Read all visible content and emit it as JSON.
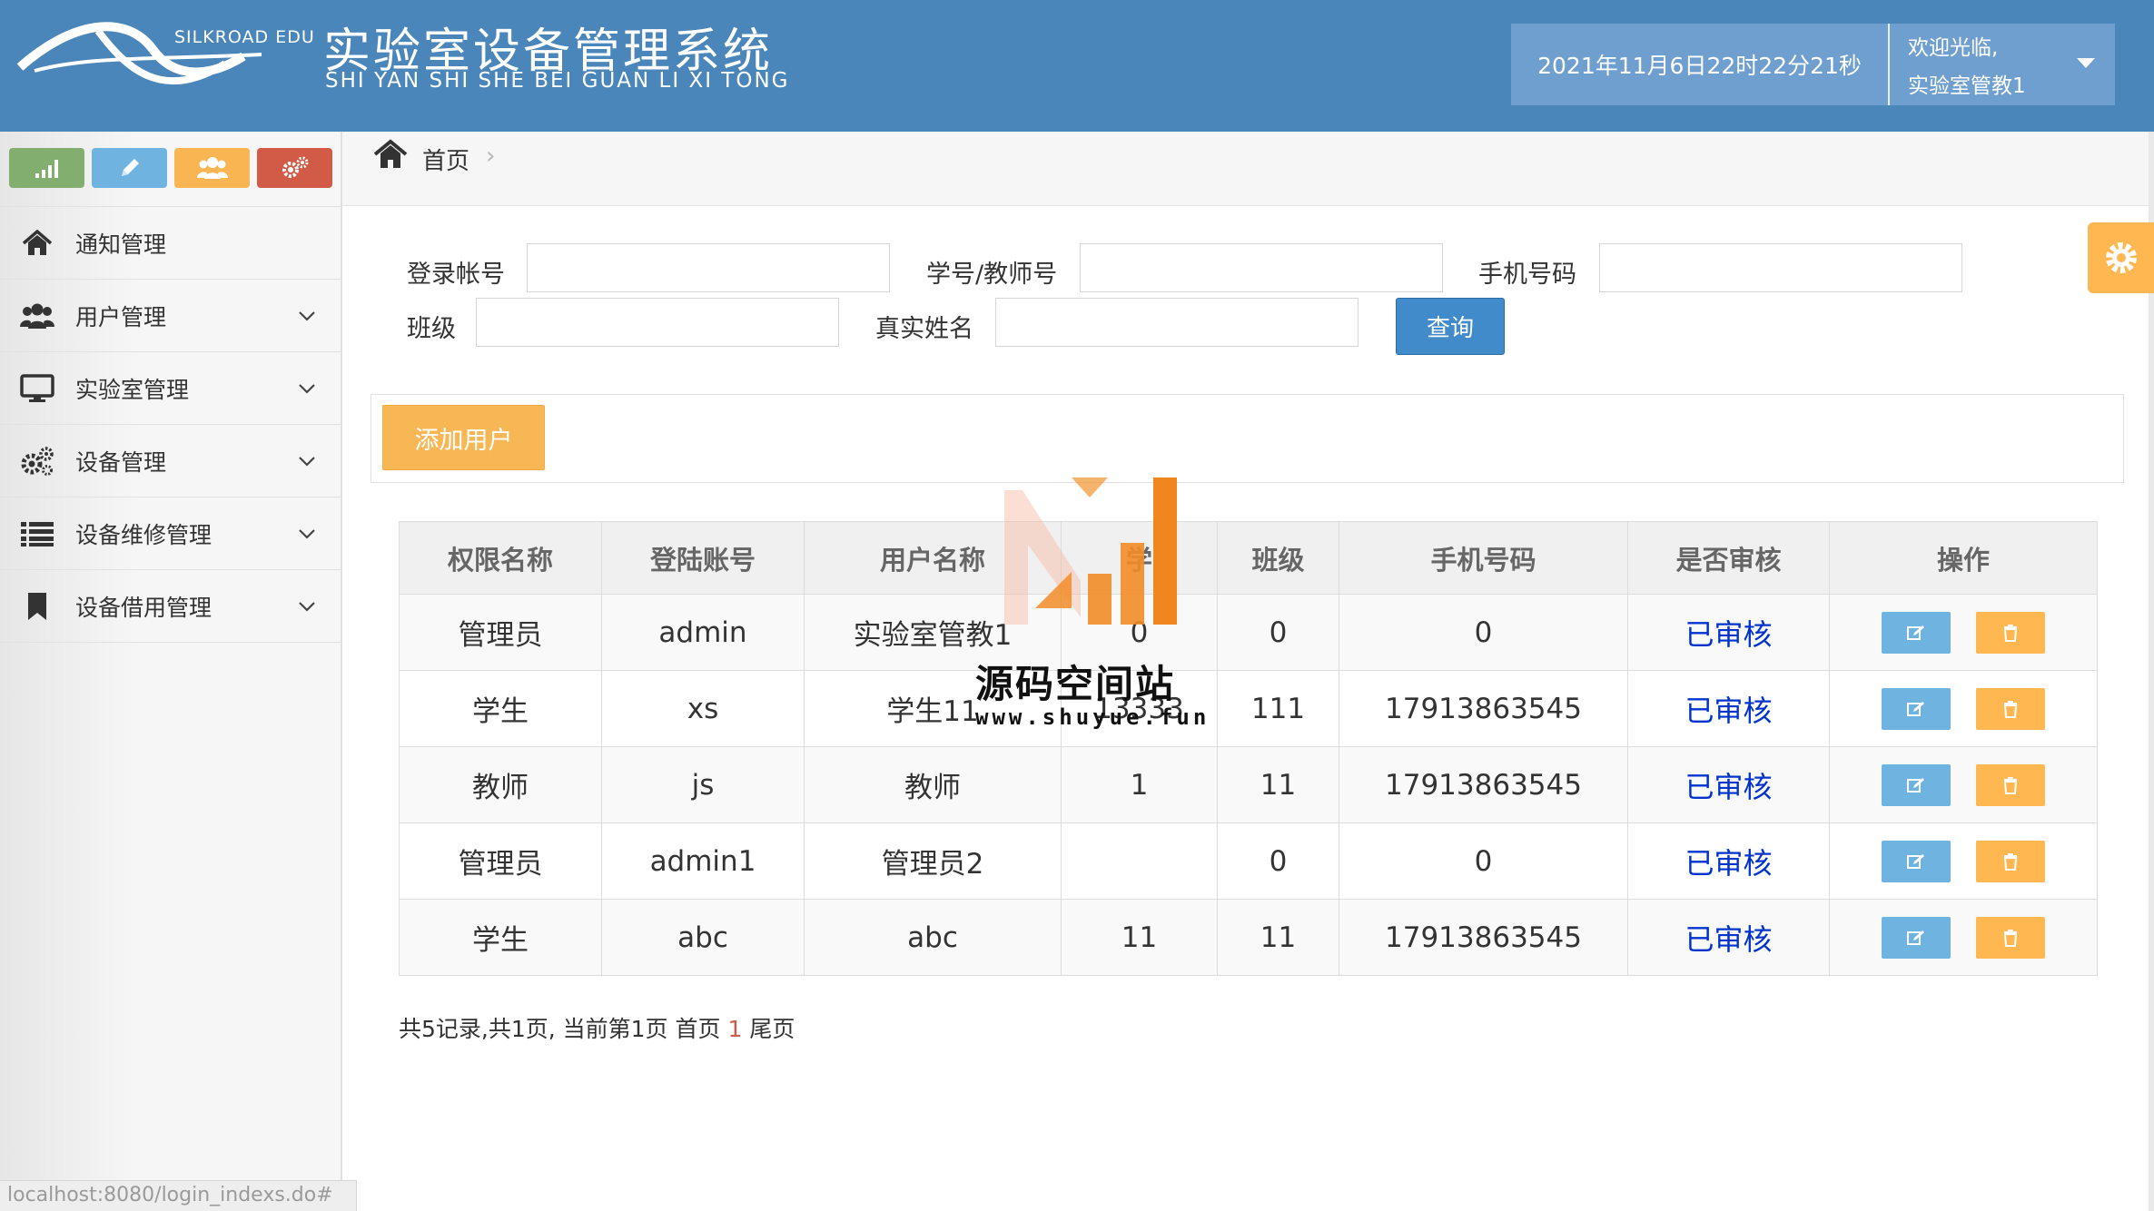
{
  "header": {
    "brand_en": "SILKROAD EDU",
    "title": "实验室设备管理系统",
    "subtitle": "SHI YAN SHI SHE BEI GUAN LI XI TONG",
    "datetime": "2021年11月6日22时22分21秒",
    "welcome": "欢迎光临,",
    "username": "实验室管教1"
  },
  "colors": {
    "header_bg": "#4a86ba",
    "shortcut_green": "#82af6f",
    "shortcut_blue": "#6fb3e0",
    "shortcut_orange": "#f8b551",
    "shortcut_red": "#d15b47",
    "primary": "#428bca",
    "warning": "#f8b755",
    "audited_text": "#0033cc"
  },
  "sidebar": {
    "shortcuts": [
      {
        "icon": "signal-icon"
      },
      {
        "icon": "pencil-icon"
      },
      {
        "icon": "users-icon"
      },
      {
        "icon": "cogs-icon"
      }
    ],
    "items": [
      {
        "label": "通知管理",
        "icon": "home-icon",
        "expandable": false
      },
      {
        "label": "用户管理",
        "icon": "users-icon",
        "expandable": true
      },
      {
        "label": "实验室管理",
        "icon": "desktop-icon",
        "expandable": true
      },
      {
        "label": "设备管理",
        "icon": "cogs-icon",
        "expandable": true
      },
      {
        "label": "设备维修管理",
        "icon": "list-icon",
        "expandable": true
      },
      {
        "label": "设备借用管理",
        "icon": "bookmark-icon",
        "expandable": true
      }
    ]
  },
  "status_bar": {
    "url": "localhost:8080/login_indexs.do#"
  },
  "breadcrumb": {
    "home": "首页",
    "separator": "›"
  },
  "search": {
    "login_account_label": "登录帐号",
    "login_account_value": "",
    "student_teacher_no_label": "学号/教师号",
    "student_teacher_no_value": "",
    "phone_label": "手机号码",
    "phone_value": "",
    "class_label": "班级",
    "class_value": "",
    "real_name_label": "真实姓名",
    "real_name_value": "",
    "query_button": "查询"
  },
  "toolbar": {
    "add_user_button": "添加用户"
  },
  "table": {
    "columns": [
      "权限名称",
      "登陆账号",
      "用户名称",
      "学",
      "班级",
      "手机号码",
      "是否审核",
      "操作"
    ],
    "rows": [
      {
        "role": "管理员",
        "account": "admin",
        "name": "实验室管教1",
        "no": "0",
        "class": "0",
        "phone": "0",
        "audit": "已审核"
      },
      {
        "role": "学生",
        "account": "xs",
        "name": "学生11",
        "no": "13333",
        "class": "111",
        "phone": "17913863545",
        "audit": "已审核"
      },
      {
        "role": "教师",
        "account": "js",
        "name": "教师",
        "no": "1",
        "class": "11",
        "phone": "17913863545",
        "audit": "已审核"
      },
      {
        "role": "管理员",
        "account": "admin1",
        "name": "管理员2",
        "no": "",
        "class": "0",
        "phone": "0",
        "audit": "已审核"
      },
      {
        "role": "学生",
        "account": "abc",
        "name": "abc",
        "no": "11",
        "class": "11",
        "phone": "17913863545",
        "audit": "已审核"
      }
    ]
  },
  "pagination": {
    "summary": "共5记录,共1页, 当前第1页 首页",
    "current": "1",
    "last": "尾页"
  },
  "watermark": {
    "title": "源码空间站",
    "url": "www.shuyue.fun"
  }
}
